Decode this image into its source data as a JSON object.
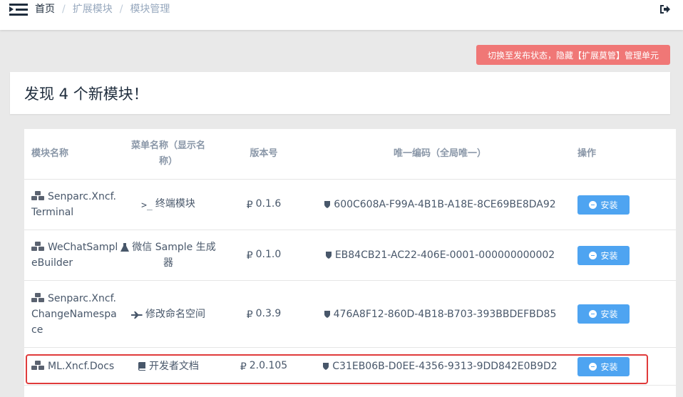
{
  "breadcrumb": {
    "home": "首页",
    "separator": "/",
    "level2": "扩展模块",
    "level3": "模块管理"
  },
  "publish_button": "切换至发布状态，隐藏【扩展莫管】管理单元",
  "header_title": "发现 4 个新模块！",
  "table": {
    "columns": [
      "模块名称",
      "菜单名称（显示名称）",
      "版本号",
      "唯一编码（全局唯一）",
      "操作"
    ],
    "rows": [
      {
        "name": "Senparc.Xncf.Terminal",
        "menu": "终端模块",
        "menu_icon": "terminal-icon",
        "version": "0.1.6",
        "uid": "600C608A-F99A-4B1B-A18E-8CE69BE8DA92",
        "action": "安装"
      },
      {
        "name": "WeChatSampleBuilder",
        "menu": "微信 Sample 生成器",
        "menu_icon": "flask-icon",
        "version": "0.1.0",
        "uid": "EB84CB21-AC22-406E-0001-000000000002",
        "action": "安装"
      },
      {
        "name": "Senparc.Xncf.ChangeNamespace",
        "menu": "修改命名空间",
        "menu_icon": "plane-icon",
        "version": "0.3.9",
        "uid": "476A8F12-860D-4B18-B703-393BBDEFBD85",
        "action": "安装"
      },
      {
        "name": "ML.Xncf.Docs",
        "menu": "开发者文档",
        "menu_icon": "book-icon",
        "version": "2.0.105",
        "uid": "C31EB06B-D0EE-4356-9313-9DD842E0B9D2",
        "action": "安装"
      }
    ]
  },
  "colors": {
    "danger": "#f07776",
    "primary": "#4ea4f1",
    "highlight_border": "#e03b3b"
  }
}
